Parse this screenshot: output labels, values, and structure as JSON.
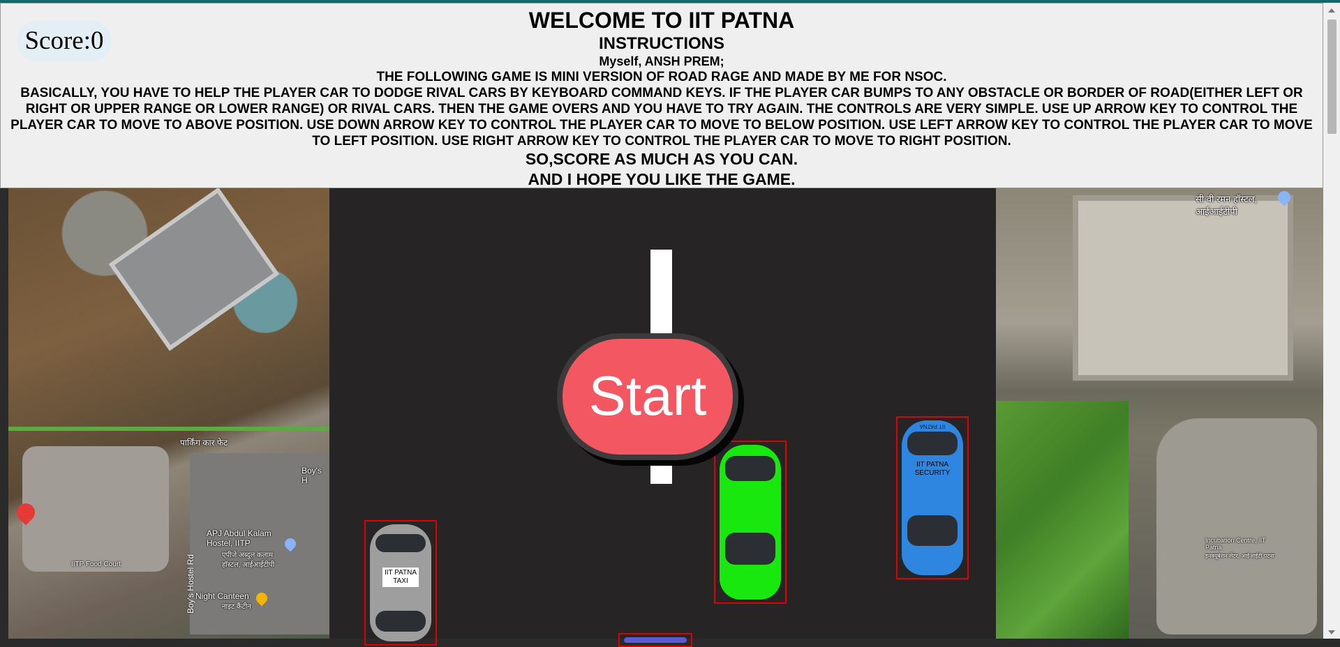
{
  "score": {
    "label": "Score:",
    "value": "0"
  },
  "instructions": {
    "title": "WELCOME TO IIT PATNA",
    "heading": "INSTRUCTIONS",
    "author": "Myself, ANSH PREM;",
    "line1": "THE FOLLOWING GAME IS MINI VERSION OF ROAD RAGE AND MADE BY ME FOR NSOC.",
    "line2": "BASICALLY, YOU HAVE TO HELP THE PLAYER CAR TO DODGE RIVAL CARS BY KEYBOARD COMMAND KEYS. IF THE PLAYER CAR BUMPS TO ANY OBSTACLE OR BORDER OF ROAD(EITHER LEFT OR RIGHT OR UPPER RANGE OR LOWER RANGE) OR RIVAL CARS. THEN THE GAME OVERS AND YOU HAVE TO TRY AGAIN. THE CONTROLS ARE VERY SIMPLE. USE UP ARROW KEY TO CONTROL THE PLAYER CAR TO MOVE TO ABOVE POSITION. USE DOWN ARROW KEY TO CONTROL THE PLAYER CAR TO MOVE TO BELOW POSITION. USE LEFT ARROW KEY TO CONTROL THE PLAYER CAR TO MOVE TO LEFT POSITION. USE RIGHT ARROW KEY TO CONTROL THE PLAYER CAR TO MOVE TO RIGHT POSITION.",
    "closing1": "SO,SCORE AS MUCH AS YOU CAN.",
    "closing2": "AND I HOPE YOU LIKE THE GAME."
  },
  "start_button": {
    "label": "Start"
  },
  "cars": {
    "rival_security": {
      "plate": "IIT PATNA SECURITY",
      "top_text": "IIT PATNA"
    },
    "rival_taxi": {
      "plate": "IIT PATNA TAXI"
    }
  },
  "map_labels": {
    "left": [
      "Boy's H",
      "APJ Abdul Kalam Hostel, IITP",
      "एपीजे अब्दुल कलाम हॉस्टल, आईआईटीपी",
      "IITP Food Court",
      "Night Canteen",
      "नाइट कैंटीन",
      "Boy's Hostel Rd",
      "पार्किंग कार फेट"
    ],
    "right": [
      "सी वी रमन हॉस्टल, आईआईटीपी",
      "Incubation Centre, IIT Patna",
      "इनक्यूबेशन सेंटर, आईआईटी पटना"
    ]
  },
  "colors": {
    "road": "#262424",
    "start_button": "#f25762",
    "player_car": "#19e80e",
    "security_car": "#2f86e0",
    "taxi_car": "#9e9e9e",
    "hitbox": "#e00000"
  }
}
